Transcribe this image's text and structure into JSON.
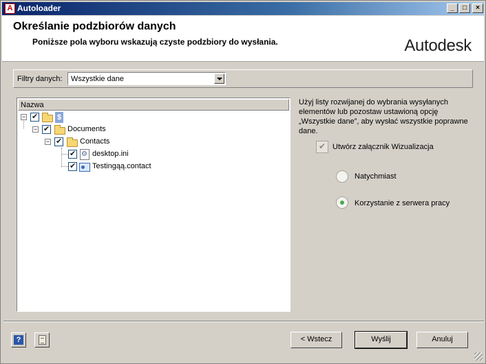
{
  "window": {
    "title": "Autoloader",
    "minimize": "_",
    "maximize": "□",
    "close": "×"
  },
  "header": {
    "title": "Określanie podzbiorów danych",
    "subtitle": "Poniższe pola wyboru wskazują czyste podzbiory do wysłania.",
    "logo": "Autodesk"
  },
  "filter": {
    "label": "Filtry danych:",
    "value": "Wszystkie dane"
  },
  "tree": {
    "column": "Nazwa",
    "nodes": [
      {
        "label": "$",
        "checked": true
      },
      {
        "label": "Documents",
        "checked": true
      },
      {
        "label": "Contacts",
        "checked": true
      },
      {
        "label": "desktop.ini",
        "checked": true
      },
      {
        "label": "Testingąą.contact",
        "checked": true
      }
    ]
  },
  "panel": {
    "info": "Użyj listy rozwijanej do wybrania wysyłanych elementów lub pozostaw ustawioną opcję „Wszystkie dane”, aby wysłać wszystkie poprawne dane.",
    "attach_label": "Utwórz załącznik Wizualizacja",
    "radio_now": "Natychmiast",
    "radio_server": "Korzystanie z serwera pracy"
  },
  "footer": {
    "help": "?",
    "back": "< Wstecz",
    "send": "Wyślij",
    "cancel": "Anuluj"
  }
}
